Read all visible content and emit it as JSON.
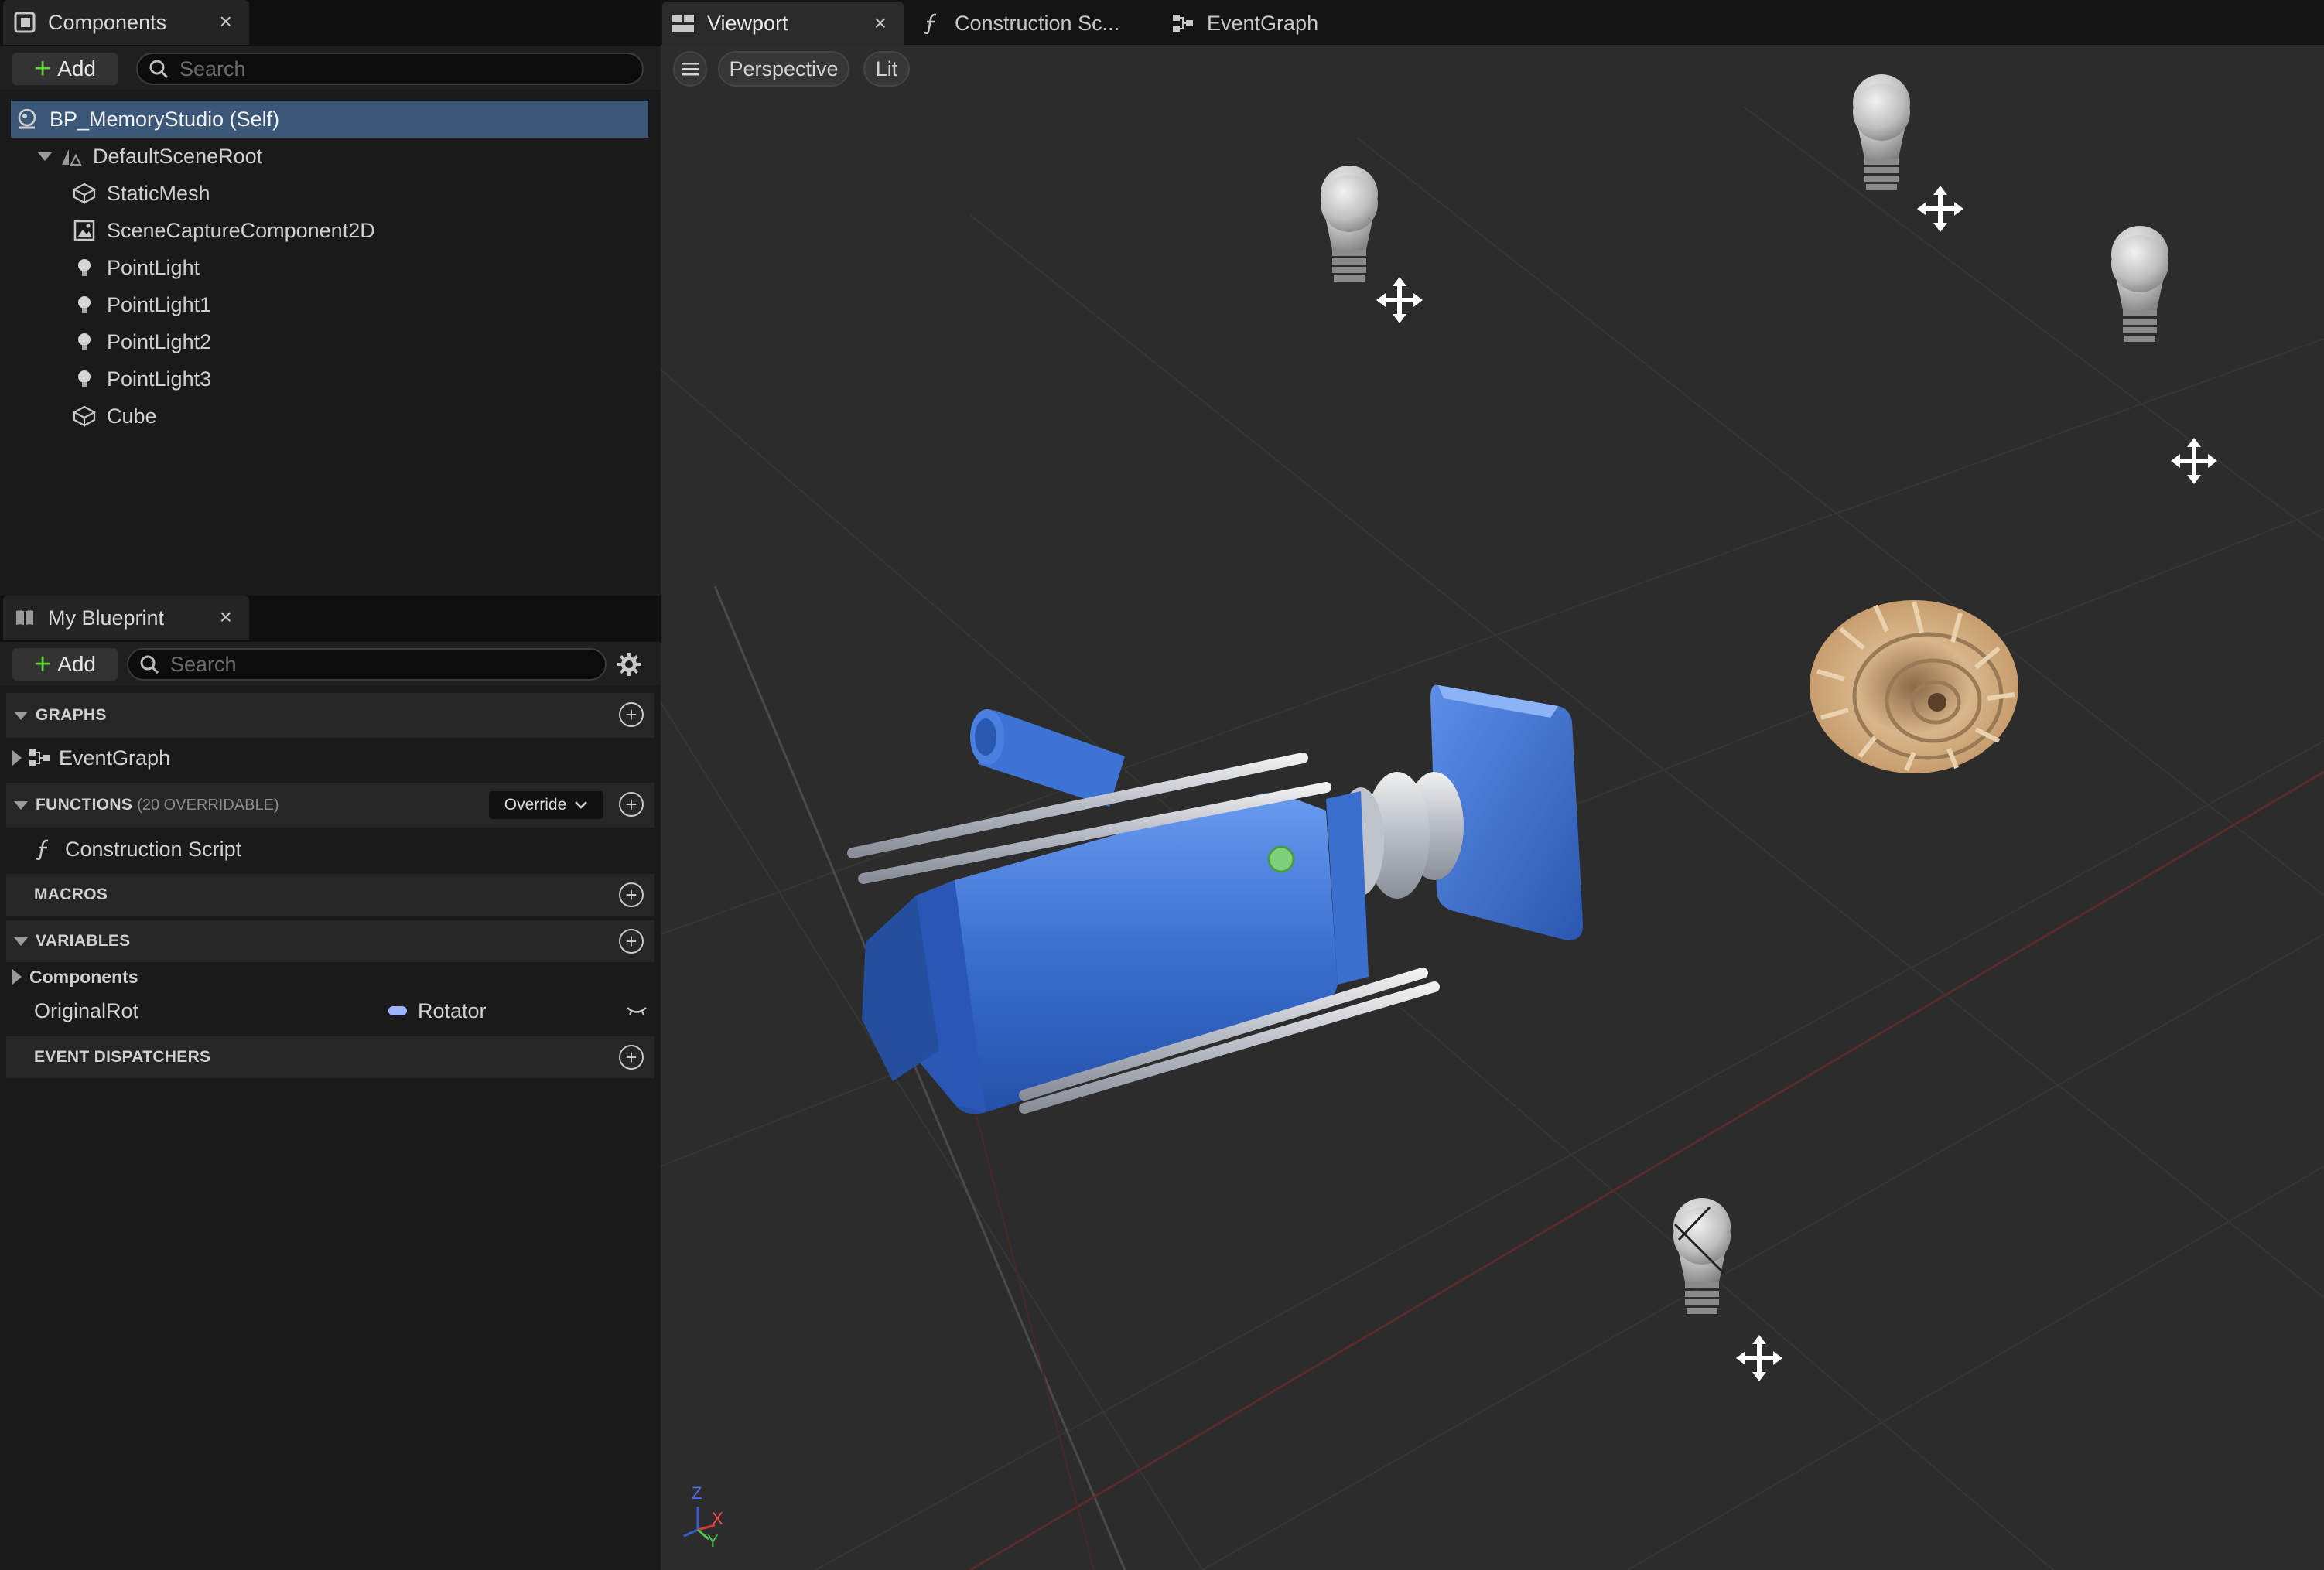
{
  "components_panel": {
    "tab_title": "Components",
    "close_glyph": "×",
    "add_label": "Add",
    "search_placeholder": "Search",
    "tree": [
      {
        "label": "BP_MemoryStudio (Self)",
        "icon": "actor-self-icon",
        "selected": true
      },
      {
        "label": "DefaultSceneRoot",
        "icon": "scene-root-icon",
        "expanded": true
      },
      {
        "label": "StaticMesh",
        "icon": "static-mesh-icon"
      },
      {
        "label": "SceneCaptureComponent2D",
        "icon": "scene-capture-icon"
      },
      {
        "label": "PointLight",
        "icon": "point-light-icon"
      },
      {
        "label": "PointLight1",
        "icon": "point-light-icon"
      },
      {
        "label": "PointLight2",
        "icon": "point-light-icon"
      },
      {
        "label": "PointLight3",
        "icon": "point-light-icon"
      },
      {
        "label": "Cube",
        "icon": "static-mesh-icon"
      }
    ]
  },
  "my_blueprint_panel": {
    "tab_title": "My Blueprint",
    "close_glyph": "×",
    "add_label": "Add",
    "search_placeholder": "Search",
    "graphs": {
      "title": "GRAPHS",
      "items": [
        "EventGraph"
      ]
    },
    "functions": {
      "title": "FUNCTIONS",
      "subtitle": "(20 OVERRIDABLE)",
      "override_label": "Override",
      "items": [
        "Construction Script"
      ]
    },
    "macros": {
      "title": "MACROS"
    },
    "variables": {
      "title": "VARIABLES",
      "category": "Components",
      "items": [
        {
          "name": "OriginalRot",
          "type": "Rotator",
          "type_color": "#9db4ff"
        }
      ]
    },
    "dispatchers": {
      "title": "EVENT DISPATCHERS"
    }
  },
  "editor_tabs": [
    {
      "label": "Viewport",
      "icon": "viewport-icon",
      "active": true
    },
    {
      "label": "Construction Sc...",
      "icon": "function-icon"
    },
    {
      "label": "EventGraph",
      "icon": "graph-icon"
    }
  ],
  "viewport": {
    "menu_icon": "hamburger-icon",
    "view_mode": "Perspective",
    "lighting_mode": "Lit",
    "axis": {
      "z": "Z",
      "x": "X",
      "y": "Y"
    }
  },
  "colors": {
    "selection": "#3b5778",
    "camera_body": "#3a6fd0",
    "add_plus": "#5bd63a",
    "viewport_bg": "#2c2c2c"
  }
}
